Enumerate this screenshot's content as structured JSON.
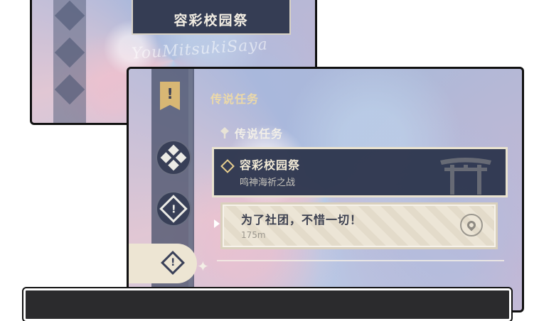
{
  "back_panel": {
    "event_title": "容彩校园祭",
    "watermark": "YouMitsukiSaya"
  },
  "front_panel": {
    "category_title": "传说任务",
    "category_subtitle": "传说任务",
    "quest": {
      "title": "容彩校园祭",
      "subtitle": "鸣神海祈之战"
    },
    "step": {
      "title": "为了社团，不惜一切！",
      "distance": "175m"
    }
  },
  "colors": {
    "rail": "#4a526c",
    "quest_card": "#2e364e",
    "gold_accent": "#d8b774",
    "cream": "#ece5d6"
  },
  "icons": [
    "quest-flag-icon",
    "daily-commission-icon",
    "compass-icon",
    "legend-quest-icon",
    "location-pin-icon",
    "sparkle-icon",
    "torii-gate-icon"
  ]
}
